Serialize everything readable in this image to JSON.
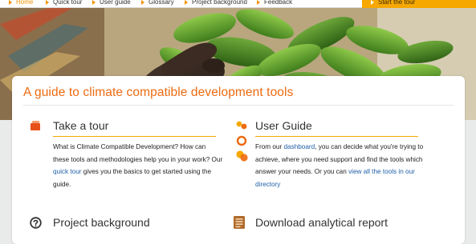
{
  "nav": {
    "items": [
      {
        "label": "Home",
        "active": true
      },
      {
        "label": "Quick tour"
      },
      {
        "label": "User guide"
      },
      {
        "label": "Glossary"
      },
      {
        "label": "Project background"
      },
      {
        "label": "Feedback"
      }
    ],
    "cta_label": "Start the tour"
  },
  "page": {
    "title": "A guide to climate compatible development tools"
  },
  "sections": {
    "tour": {
      "title": "Take a tour",
      "text_a": "What is Climate Compatible Development? How can these tools and methodologies help you in your work? Our ",
      "link": "quick tour",
      "text_b": " gives you the basics to get started using the guide."
    },
    "guide": {
      "title": "User Guide",
      "text_a": "From our ",
      "link_a": "dashboard",
      "text_b": ", you can decide what you're trying to achieve, where you need support and find the tools which answer your needs. Or you can ",
      "link_b": "view all the tools in our directory"
    },
    "background": {
      "title": "Project background"
    },
    "report": {
      "title": "Download analytical report"
    }
  },
  "colors": {
    "accent_orange": "#ee6a10",
    "nav_yellow": "#f6a800",
    "link_blue": "#1f5fa8"
  },
  "icons": {
    "tour": "flag-icon",
    "guide": "user-guide-icon",
    "background": "question-circle-icon",
    "report": "document-icon"
  }
}
